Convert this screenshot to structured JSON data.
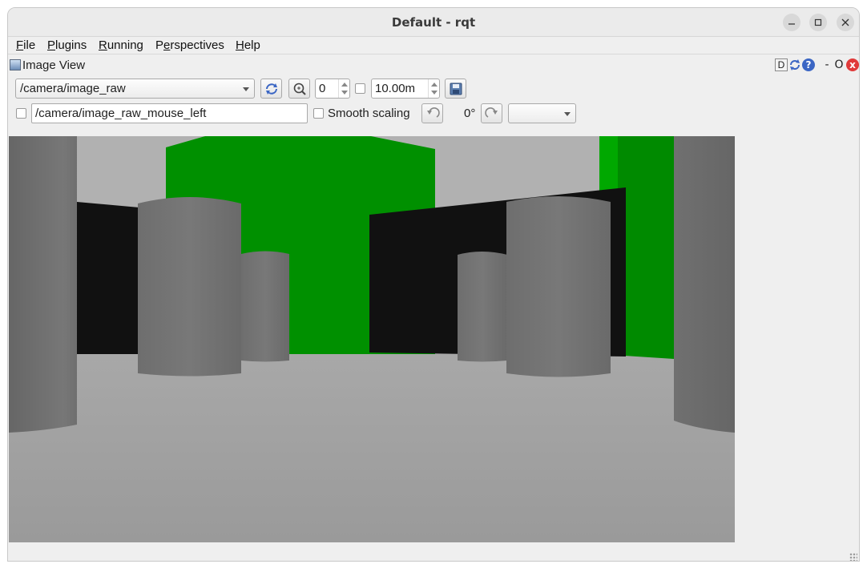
{
  "window": {
    "title": "Default - rqt"
  },
  "menu": [
    {
      "label_u": "F",
      "label_rest": "ile"
    },
    {
      "label_u": "P",
      "label_rest": "lugins"
    },
    {
      "label_u": "R",
      "label_rest": "unning"
    },
    {
      "label_pre": "P",
      "label_u": "e",
      "label_rest": "rspectives"
    },
    {
      "label_u": "H",
      "label_rest": "elp"
    }
  ],
  "plugin": {
    "title": "Image View",
    "dock_labels": {
      "d": "D",
      "help": "?",
      "minimize": "-",
      "float": "O",
      "close": "x"
    }
  },
  "toolbar": {
    "topic": "/camera/image_raw",
    "image_count": "0",
    "duration": "10.00m",
    "mouse_topic": "/camera/image_raw_mouse_left",
    "smooth_scaling_label": "Smooth scaling",
    "rotation": "0°",
    "color_scheme": ""
  },
  "icons": {
    "refresh": "refresh-icon",
    "zoom": "zoom-icon",
    "save": "save-icon",
    "rotate_left": "rotate-left-icon",
    "rotate_right": "rotate-right-icon"
  },
  "colors": {
    "wall_green": "#009000",
    "wall_black": "#111111",
    "pillar_gray": "#757575",
    "floor": "#a0a0a0",
    "sky": "#b0b0b0"
  }
}
